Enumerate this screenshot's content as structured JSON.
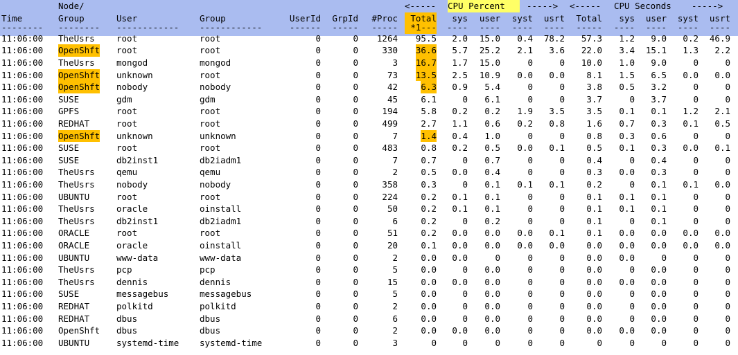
{
  "title_row": {
    "node": "Node/",
    "cpu_pct_left": "<-----",
    "cpu_pct_label": "CPU Percent",
    "cpu_pct_right": "----->",
    "cpu_sec_left": "<-----",
    "cpu_sec_label": "CPU Seconds",
    "cpu_sec_right": "----->"
  },
  "columns": [
    "Time",
    "Group",
    "User",
    "Group",
    "UserId",
    "GrpId",
    "#Proc",
    "Total",
    "sys",
    "user",
    "syst",
    "usrt",
    "Total",
    "sys",
    "user",
    "syst",
    "usrt"
  ],
  "dashes": [
    "--------",
    "--------",
    "------------",
    "------------",
    "------",
    "-----",
    "-----",
    "*1---",
    "----",
    "----",
    "----",
    "----",
    "-----",
    "----",
    "----",
    "----",
    "----"
  ],
  "rows": [
    {
      "time": "11:06:00",
      "node": "TheUsrs",
      "user": "root",
      "group": "root",
      "uid": "0",
      "gid": "0",
      "proc": "1264",
      "total": "95.5",
      "sys": "2.0",
      "usr": "15.0",
      "syst": "0.4",
      "usrt": "78.2",
      "stotal": "57.3",
      "ssys": "1.2",
      "susr": "9.0",
      "ssyst": "0.2",
      "susrt": "46.9"
    },
    {
      "time": "11:06:00",
      "node": "OpenShft",
      "user": "root",
      "group": "root",
      "uid": "0",
      "gid": "0",
      "proc": "330",
      "total": "36.6",
      "sys": "5.7",
      "usr": "25.2",
      "syst": "2.1",
      "usrt": "3.6",
      "stotal": "22.0",
      "ssys": "3.4",
      "susr": "15.1",
      "ssyst": "1.3",
      "susrt": "2.2"
    },
    {
      "time": "11:06:00",
      "node": "TheUsrs",
      "user": "mongod",
      "group": "mongod",
      "uid": "0",
      "gid": "0",
      "proc": "3",
      "total": "16.7",
      "sys": "1.7",
      "usr": "15.0",
      "syst": "0",
      "usrt": "0",
      "stotal": "10.0",
      "ssys": "1.0",
      "susr": "9.0",
      "ssyst": "0",
      "susrt": "0"
    },
    {
      "time": "11:06:00",
      "node": "OpenShft",
      "user": "unknown",
      "group": "root",
      "uid": "0",
      "gid": "0",
      "proc": "73",
      "total": "13.5",
      "sys": "2.5",
      "usr": "10.9",
      "syst": "0.0",
      "usrt": "0.0",
      "stotal": "8.1",
      "ssys": "1.5",
      "susr": "6.5",
      "ssyst": "0.0",
      "susrt": "0.0"
    },
    {
      "time": "11:06:00",
      "node": "OpenShft",
      "user": "nobody",
      "group": "nobody",
      "uid": "0",
      "gid": "0",
      "proc": "42",
      "total": "6.3",
      "sys": "0.9",
      "usr": "5.4",
      "syst": "0",
      "usrt": "0",
      "stotal": "3.8",
      "ssys": "0.5",
      "susr": "3.2",
      "ssyst": "0",
      "susrt": "0"
    },
    {
      "time": "11:06:00",
      "node": "SUSE",
      "user": "gdm",
      "group": "gdm",
      "uid": "0",
      "gid": "0",
      "proc": "45",
      "total": "6.1",
      "sys": "0",
      "usr": "6.1",
      "syst": "0",
      "usrt": "0",
      "stotal": "3.7",
      "ssys": "0",
      "susr": "3.7",
      "ssyst": "0",
      "susrt": "0"
    },
    {
      "time": "11:06:00",
      "node": "GPFS",
      "user": "root",
      "group": "root",
      "uid": "0",
      "gid": "0",
      "proc": "194",
      "total": "5.8",
      "sys": "0.2",
      "usr": "0.2",
      "syst": "1.9",
      "usrt": "3.5",
      "stotal": "3.5",
      "ssys": "0.1",
      "susr": "0.1",
      "ssyst": "1.2",
      "susrt": "2.1"
    },
    {
      "time": "11:06:00",
      "node": "REDHAT",
      "user": "root",
      "group": "root",
      "uid": "0",
      "gid": "0",
      "proc": "499",
      "total": "2.7",
      "sys": "1.1",
      "usr": "0.6",
      "syst": "0.2",
      "usrt": "0.8",
      "stotal": "1.6",
      "ssys": "0.7",
      "susr": "0.3",
      "ssyst": "0.1",
      "susrt": "0.5"
    },
    {
      "time": "11:06:00",
      "node": "OpenShft",
      "user": "unknown",
      "group": "unknown",
      "uid": "0",
      "gid": "0",
      "proc": "7",
      "total": "1.4",
      "sys": "0.4",
      "usr": "1.0",
      "syst": "0",
      "usrt": "0",
      "stotal": "0.8",
      "ssys": "0.3",
      "susr": "0.6",
      "ssyst": "0",
      "susrt": "0"
    },
    {
      "time": "11:06:00",
      "node": "SUSE",
      "user": "root",
      "group": "root",
      "uid": "0",
      "gid": "0",
      "proc": "483",
      "total": "0.8",
      "sys": "0.2",
      "usr": "0.5",
      "syst": "0.0",
      "usrt": "0.1",
      "stotal": "0.5",
      "ssys": "0.1",
      "susr": "0.3",
      "ssyst": "0.0",
      "susrt": "0.1"
    },
    {
      "time": "11:06:00",
      "node": "SUSE",
      "user": "db2inst1",
      "group": "db2iadm1",
      "uid": "0",
      "gid": "0",
      "proc": "7",
      "total": "0.7",
      "sys": "0",
      "usr": "0.7",
      "syst": "0",
      "usrt": "0",
      "stotal": "0.4",
      "ssys": "0",
      "susr": "0.4",
      "ssyst": "0",
      "susrt": "0"
    },
    {
      "time": "11:06:00",
      "node": "TheUsrs",
      "user": "qemu",
      "group": "qemu",
      "uid": "0",
      "gid": "0",
      "proc": "2",
      "total": "0.5",
      "sys": "0.0",
      "usr": "0.4",
      "syst": "0",
      "usrt": "0",
      "stotal": "0.3",
      "ssys": "0.0",
      "susr": "0.3",
      "ssyst": "0",
      "susrt": "0"
    },
    {
      "time": "11:06:00",
      "node": "TheUsrs",
      "user": "nobody",
      "group": "nobody",
      "uid": "0",
      "gid": "0",
      "proc": "358",
      "total": "0.3",
      "sys": "0",
      "usr": "0.1",
      "syst": "0.1",
      "usrt": "0.1",
      "stotal": "0.2",
      "ssys": "0",
      "susr": "0.1",
      "ssyst": "0.1",
      "susrt": "0.0"
    },
    {
      "time": "11:06:00",
      "node": "UBUNTU",
      "user": "root",
      "group": "root",
      "uid": "0",
      "gid": "0",
      "proc": "224",
      "total": "0.2",
      "sys": "0.1",
      "usr": "0.1",
      "syst": "0",
      "usrt": "0",
      "stotal": "0.1",
      "ssys": "0.1",
      "susr": "0.1",
      "ssyst": "0",
      "susrt": "0"
    },
    {
      "time": "11:06:00",
      "node": "TheUsrs",
      "user": "oracle",
      "group": "oinstall",
      "uid": "0",
      "gid": "0",
      "proc": "50",
      "total": "0.2",
      "sys": "0.1",
      "usr": "0.1",
      "syst": "0",
      "usrt": "0",
      "stotal": "0.1",
      "ssys": "0.1",
      "susr": "0.1",
      "ssyst": "0",
      "susrt": "0"
    },
    {
      "time": "11:06:00",
      "node": "TheUsrs",
      "user": "db2inst1",
      "group": "db2iadm1",
      "uid": "0",
      "gid": "0",
      "proc": "6",
      "total": "0.2",
      "sys": "0",
      "usr": "0.2",
      "syst": "0",
      "usrt": "0",
      "stotal": "0.1",
      "ssys": "0",
      "susr": "0.1",
      "ssyst": "0",
      "susrt": "0"
    },
    {
      "time": "11:06:00",
      "node": "ORACLE",
      "user": "root",
      "group": "root",
      "uid": "0",
      "gid": "0",
      "proc": "51",
      "total": "0.2",
      "sys": "0.0",
      "usr": "0.0",
      "syst": "0.0",
      "usrt": "0.1",
      "stotal": "0.1",
      "ssys": "0.0",
      "susr": "0.0",
      "ssyst": "0.0",
      "susrt": "0.0"
    },
    {
      "time": "11:06:00",
      "node": "ORACLE",
      "user": "oracle",
      "group": "oinstall",
      "uid": "0",
      "gid": "0",
      "proc": "20",
      "total": "0.1",
      "sys": "0.0",
      "usr": "0.0",
      "syst": "0.0",
      "usrt": "0.0",
      "stotal": "0.0",
      "ssys": "0.0",
      "susr": "0.0",
      "ssyst": "0.0",
      "susrt": "0.0"
    },
    {
      "time": "11:06:00",
      "node": "UBUNTU",
      "user": "www-data",
      "group": "www-data",
      "uid": "0",
      "gid": "0",
      "proc": "2",
      "total": "0.0",
      "sys": "0.0",
      "usr": "0",
      "syst": "0",
      "usrt": "0",
      "stotal": "0.0",
      "ssys": "0.0",
      "susr": "0",
      "ssyst": "0",
      "susrt": "0"
    },
    {
      "time": "11:06:00",
      "node": "TheUsrs",
      "user": "pcp",
      "group": "pcp",
      "uid": "0",
      "gid": "0",
      "proc": "5",
      "total": "0.0",
      "sys": "0",
      "usr": "0.0",
      "syst": "0",
      "usrt": "0",
      "stotal": "0.0",
      "ssys": "0",
      "susr": "0.0",
      "ssyst": "0",
      "susrt": "0"
    },
    {
      "time": "11:06:00",
      "node": "TheUsrs",
      "user": "dennis",
      "group": "dennis",
      "uid": "0",
      "gid": "0",
      "proc": "15",
      "total": "0.0",
      "sys": "0.0",
      "usr": "0.0",
      "syst": "0",
      "usrt": "0",
      "stotal": "0.0",
      "ssys": "0.0",
      "susr": "0.0",
      "ssyst": "0",
      "susrt": "0"
    },
    {
      "time": "11:06:00",
      "node": "SUSE",
      "user": "messagebus",
      "group": "messagebus",
      "uid": "0",
      "gid": "0",
      "proc": "5",
      "total": "0.0",
      "sys": "0",
      "usr": "0.0",
      "syst": "0",
      "usrt": "0",
      "stotal": "0.0",
      "ssys": "0",
      "susr": "0.0",
      "ssyst": "0",
      "susrt": "0"
    },
    {
      "time": "11:06:00",
      "node": "REDHAT",
      "user": "polkitd",
      "group": "polkitd",
      "uid": "0",
      "gid": "0",
      "proc": "2",
      "total": "0.0",
      "sys": "0",
      "usr": "0.0",
      "syst": "0",
      "usrt": "0",
      "stotal": "0.0",
      "ssys": "0",
      "susr": "0.0",
      "ssyst": "0",
      "susrt": "0"
    },
    {
      "time": "11:06:00",
      "node": "REDHAT",
      "user": "dbus",
      "group": "dbus",
      "uid": "0",
      "gid": "0",
      "proc": "6",
      "total": "0.0",
      "sys": "0",
      "usr": "0.0",
      "syst": "0",
      "usrt": "0",
      "stotal": "0.0",
      "ssys": "0",
      "susr": "0.0",
      "ssyst": "0",
      "susrt": "0"
    },
    {
      "time": "11:06:00",
      "node": "OpenShft",
      "user": "dbus",
      "group": "dbus",
      "uid": "0",
      "gid": "0",
      "proc": "2",
      "total": "0.0",
      "sys": "0.0",
      "usr": "0.0",
      "syst": "0",
      "usrt": "0",
      "stotal": "0.0",
      "ssys": "0.0",
      "susr": "0.0",
      "ssyst": "0",
      "susrt": "0"
    },
    {
      "time": "11:06:00",
      "node": "UBUNTU",
      "user": "systemd-time",
      "group": "systemd-time",
      "uid": "0",
      "gid": "0",
      "proc": "3",
      "total": "0",
      "sys": "0",
      "usr": "0",
      "syst": "0",
      "usrt": "0",
      "stotal": "0",
      "ssys": "0",
      "susr": "0",
      "ssyst": "0",
      "susrt": "0"
    }
  ],
  "highlight_node_rows": [
    1,
    3,
    4,
    8
  ],
  "highlight_total_rows": [
    1,
    2,
    3,
    4,
    8
  ],
  "colors": {
    "header_bg": "#aabcf0",
    "highlight": "#ffc000",
    "label_highlight": "#ffff66"
  }
}
